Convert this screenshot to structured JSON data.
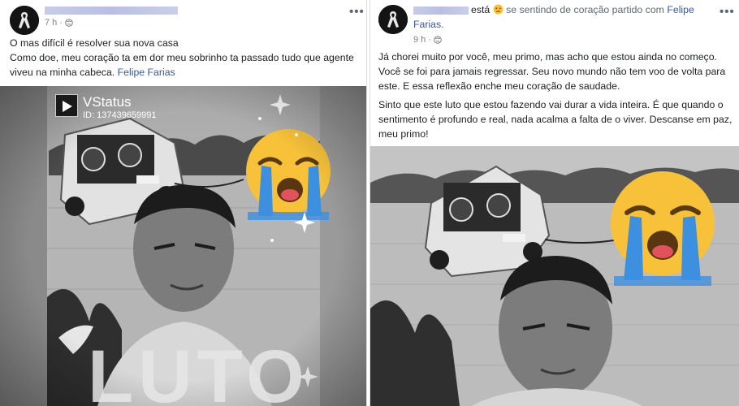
{
  "left_post": {
    "time": "7 h",
    "more": "•••",
    "lines": [
      "O mas difícil é resolver sua nova casa",
      "Como doe, meu coração ta em dor meu sobrinho ta passado tudo que agente",
      "viveu na minha cabeca."
    ],
    "tag": "Felipe Farias",
    "watermark_title": "VStatus",
    "watermark_id": "ID: 137439659991",
    "overlay_word": "LUTO"
  },
  "right_post": {
    "status_verb": "está",
    "status_text": "se sentindo de coração partido com",
    "tag_first": "Felipe",
    "tag_last": "Farias.",
    "time": "9 h",
    "more": "•••",
    "paragraph1": "Já chorei muito por você, meu primo, mas acho que estou ainda no começo. Você se foi para jamais regressar. Seu novo mundo não tem voo de volta para este. E essa reflexão enche meu coração de saudade.",
    "paragraph2": "Sinto que este luto que estou fazendo vai durar a vida inteira. É que quando o sentimento é profundo e real, nada acalma a falta de o viver. Descanse em paz, meu primo!"
  },
  "colors": {
    "link": "#385898",
    "meta": "#7a7f86",
    "emoji_face": "#f7c23a",
    "emoji_tear": "#3d8fe0",
    "emoji_mouth": "#e2525c"
  }
}
